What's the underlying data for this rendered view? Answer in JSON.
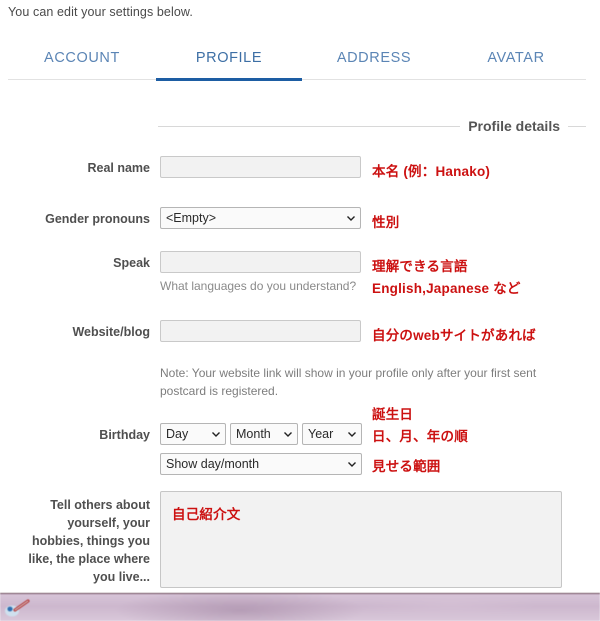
{
  "page": {
    "notice": "You can edit your settings below."
  },
  "tabs": [
    {
      "label": "ACCOUNT",
      "active": false
    },
    {
      "label": "PROFILE",
      "active": true
    },
    {
      "label": "ADDRESS",
      "active": false
    },
    {
      "label": "AVATAR",
      "active": false
    }
  ],
  "section": {
    "title": "Profile details"
  },
  "form": {
    "real_name": {
      "label": "Real name",
      "value": "",
      "annotation": "本名 (例：Hanako)"
    },
    "gender_pronouns": {
      "label": "Gender pronouns",
      "selected": "<Empty>",
      "annotation": "性別"
    },
    "speak": {
      "label": "Speak",
      "value": "",
      "hint": "What languages do you understand?",
      "annotation_line1": "理解できる言語",
      "annotation_line2": "English,Japanese など"
    },
    "website": {
      "label": "Website/blog",
      "value": "",
      "annotation": "自分のwebサイトがあれば",
      "note": "Note: Your website link will show in your profile only after your first sent postcard is registered."
    },
    "birthday": {
      "label": "Birthday",
      "day": "Day",
      "month": "Month",
      "year": "Year",
      "visibility": "Show day/month",
      "annotation_line1": "誕生日",
      "annotation_line2": "日、月、年の順",
      "annotation_line3": "見せる範囲"
    },
    "about": {
      "label": "Tell others about yourself, your hobbies, things you like, the place where you live...",
      "value": "",
      "annotation": "自己紹介文"
    }
  },
  "colors": {
    "tab_active": "#1d5da3",
    "tab_text": "#5b85b5",
    "annotation_red": "#cc1111"
  }
}
